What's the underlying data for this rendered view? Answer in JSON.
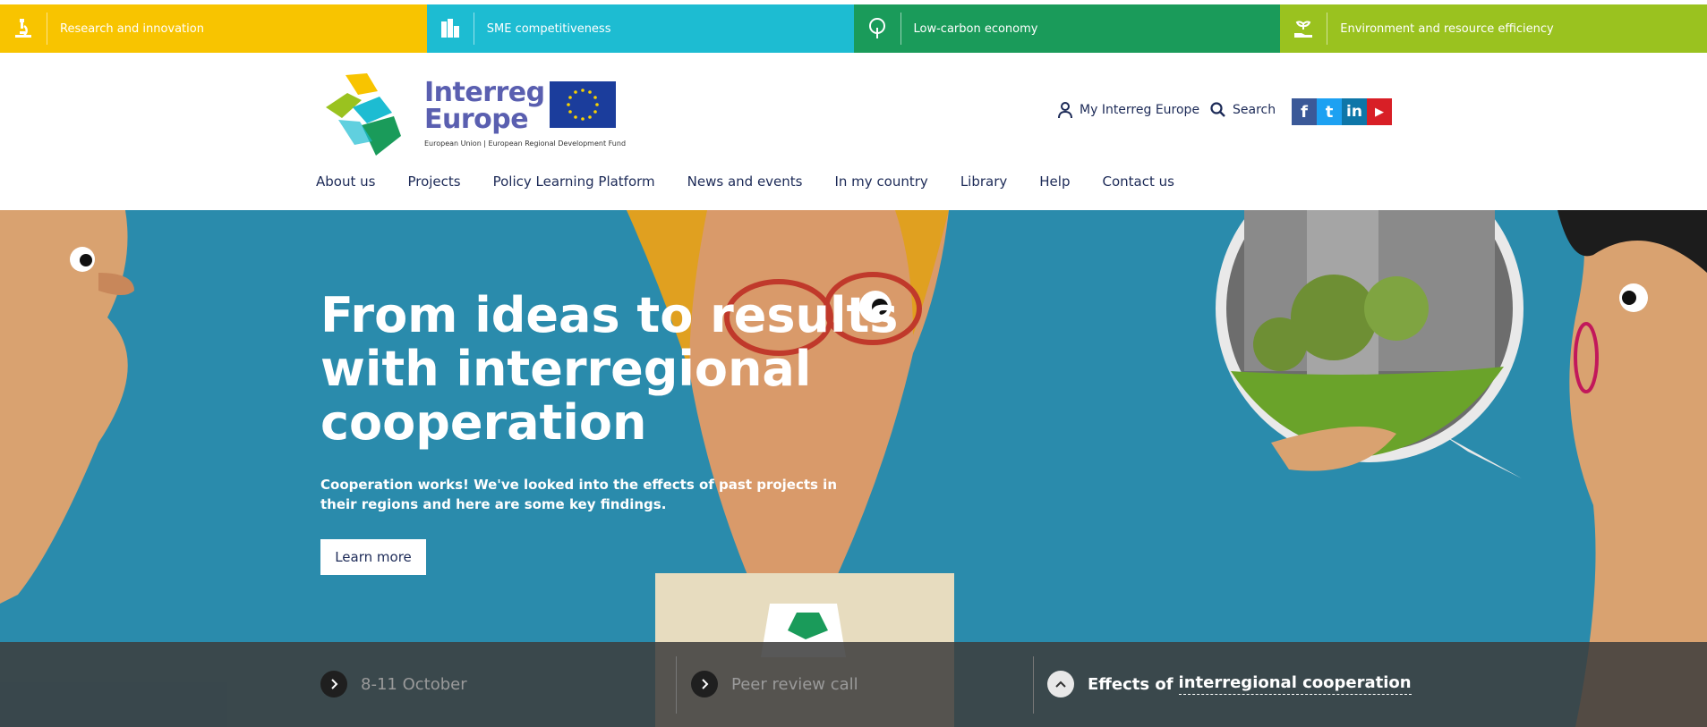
{
  "topics": [
    {
      "label": "Research and innovation",
      "color": "#f8c400",
      "icon": "microscope-icon"
    },
    {
      "label": "SME competitiveness",
      "color": "#1dbcd2",
      "icon": "buildings-icon"
    },
    {
      "label": "Low-carbon economy",
      "color": "#1a9b5a",
      "icon": "tree-icon"
    },
    {
      "label": "Environment and resource efficiency",
      "color": "#9ac21f",
      "icon": "hand-plant-icon"
    }
  ],
  "logo": {
    "line1": "Interreg",
    "line2": "Europe",
    "sub": "European Union | European Regional Development Fund"
  },
  "header": {
    "my_interreg": "My Interreg Europe",
    "search": "Search"
  },
  "social": [
    {
      "name": "facebook",
      "glyph": "f",
      "color": "#3b5998"
    },
    {
      "name": "twitter",
      "glyph": "t",
      "color": "#1da1f2"
    },
    {
      "name": "linkedin",
      "glyph": "in",
      "color": "#0e76a8"
    },
    {
      "name": "youtube",
      "glyph": "▶",
      "color": "#d81f26"
    }
  ],
  "nav": [
    "About us",
    "Projects",
    "Policy Learning Platform",
    "News and events",
    "In my country",
    "Library",
    "Help",
    "Contact us"
  ],
  "hero": {
    "title": "From ideas to results with interregional cooperation",
    "text": "Cooperation works! We've looked into the effects of past projects in their regions and here are some key findings.",
    "button": "Learn more"
  },
  "slider_tabs": [
    {
      "label": "8-11 October"
    },
    {
      "label": "Peer review call"
    },
    {
      "label_plain": "Effects of",
      "label_link": "interregional cooperation"
    }
  ]
}
